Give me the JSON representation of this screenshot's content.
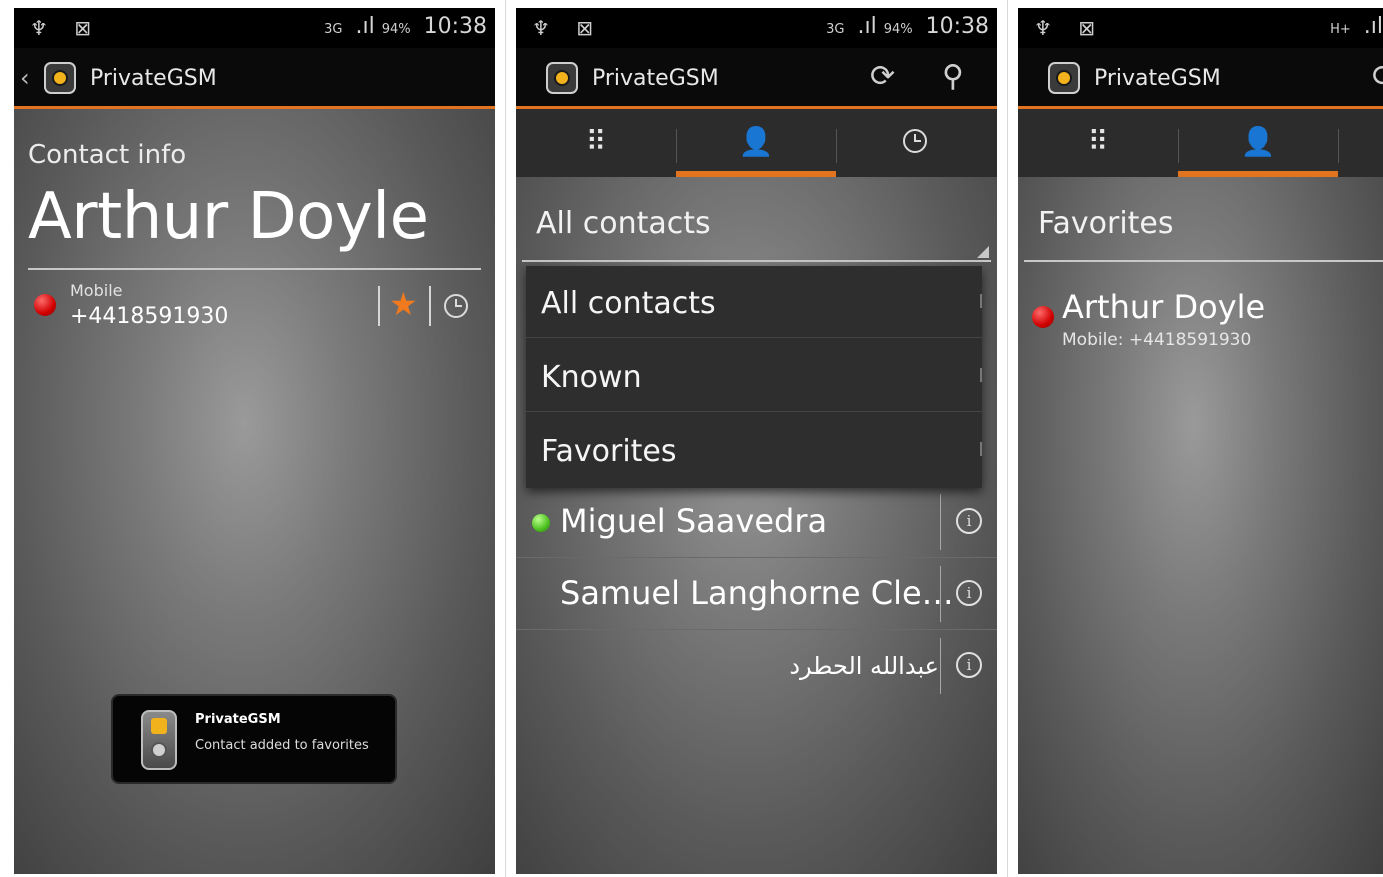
{
  "app": {
    "title": "PrivateGSM"
  },
  "status_bar": {
    "time": "10:38",
    "left_icons": [
      "usb-icon",
      "notification-icon"
    ],
    "network_s1": "3G",
    "network_s3": "H+",
    "battery": "94%"
  },
  "screen1": {
    "back_glyph": "‹",
    "section_label": "Contact info",
    "contact_name": "Arthur Doyle",
    "phone_type": "Mobile",
    "phone_number": "+4418591930",
    "status_color": "#d10000",
    "favorite_color": "#f07a1d",
    "toast": {
      "title": "PrivateGSM",
      "message": "Contact added to favorites"
    }
  },
  "screen2": {
    "tabs": [
      "dialpad-icon",
      "contacts-icon",
      "history-icon"
    ],
    "selected_tab": 1,
    "action_icons": [
      "sync-icon",
      "search-icon"
    ],
    "filter_label": "All contacts",
    "filter_options": [
      "All contacts",
      "Known",
      "Favorites"
    ],
    "contacts": [
      {
        "name": "Miguel Saavedra",
        "status": "online"
      },
      {
        "name": "Samuel Langhorne Cle…",
        "status": "none"
      },
      {
        "name": "عبدالله الحطرد",
        "status": "none"
      }
    ],
    "info_glyph": "i"
  },
  "screen3": {
    "filter_label": "Favorites",
    "contact_name": "Arthur Doyle",
    "contact_detail": "Mobile: +4418591930"
  },
  "colors": {
    "accent": "#e2731f",
    "online": "#4cc01f",
    "offline": "#d10000"
  }
}
